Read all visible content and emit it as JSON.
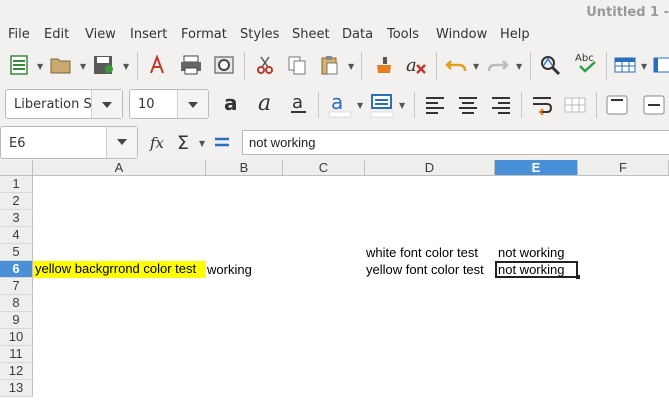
{
  "window": {
    "title": "Untitled 1 -"
  },
  "menu": [
    "File",
    "Edit",
    "View",
    "Insert",
    "Format",
    "Styles",
    "Sheet",
    "Data",
    "Tools",
    "Window",
    "Help"
  ],
  "toolbar": {
    "font_name": "Liberation S",
    "font_size": "10"
  },
  "formula": {
    "cell_ref": "E6",
    "content": "not working"
  },
  "columns": [
    "A",
    "B",
    "C",
    "D",
    "E",
    "F"
  ],
  "rows": [
    "1",
    "2",
    "3",
    "4",
    "5",
    "6",
    "7",
    "8",
    "9",
    "10",
    "11",
    "12",
    "13"
  ],
  "selected_cell": {
    "column": "E",
    "row": "6"
  },
  "cells": {
    "A6": "yellow backgrrond color test",
    "B6": "working",
    "D5": "white font color test",
    "E5": "not working",
    "D6": "yellow font color test",
    "E6": "not working"
  },
  "colors": {
    "selection": "#4a90d9",
    "highlight_yellow": "#ffff00"
  }
}
